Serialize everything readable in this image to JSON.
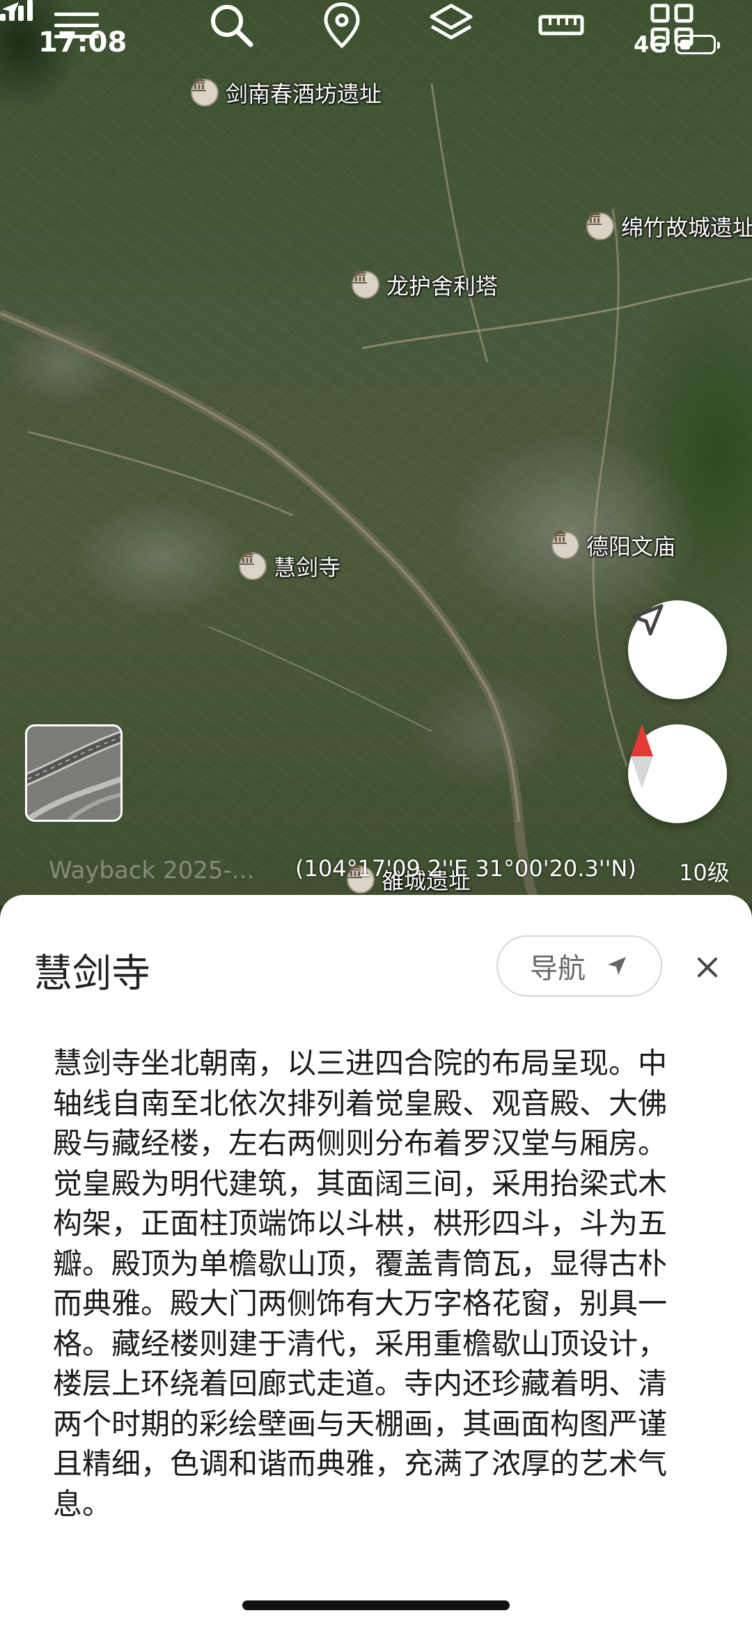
{
  "status_bar": {
    "time": "17:08",
    "network": "4G"
  },
  "toolbar": {
    "icons": [
      "menu-icon",
      "search-icon",
      "location-pin-icon",
      "layers-icon",
      "ruler-icon",
      "grid-icon"
    ]
  },
  "map": {
    "pois": [
      {
        "name": "剑南春酒坊遗址"
      },
      {
        "name": "绵竹故城遗址"
      },
      {
        "name": "龙护舍利塔"
      },
      {
        "name": "德阳文庙"
      },
      {
        "name": "慧剑寺"
      },
      {
        "name": "雒城遗址"
      }
    ],
    "wayback": "Wayback 2025-...",
    "coordinates": "(104°17'09.2''E 31°00'20.3''N)",
    "zoom_level": "10级"
  },
  "sheet": {
    "title": "慧剑寺",
    "nav_label": "导航",
    "description": "慧剑寺坐北朝南，以三进四合院的布局呈现。中轴线自南至北依次排列着觉皇殿、观音殿、大佛殿与藏经楼，左右两侧则分布着罗汉堂与厢房。觉皇殿为明代建筑，其面阔三间，采用抬梁式木构架，正面柱顶端饰以斗栱，栱形四斗，斗为五瓣。殿顶为单檐歇山顶，覆盖青筒瓦，显得古朴而典雅。殿大门两侧饰有大万字格花窗，别具一格。藏经楼则建于清代，采用重檐歇山顶设计，楼层上环绕着回廊式走道。寺内还珍藏着明、清两个时期的彩绘壁画与天棚画，其画面构图严谨且精细，色调和谐而典雅，充满了浓厚的艺术气息。"
  }
}
